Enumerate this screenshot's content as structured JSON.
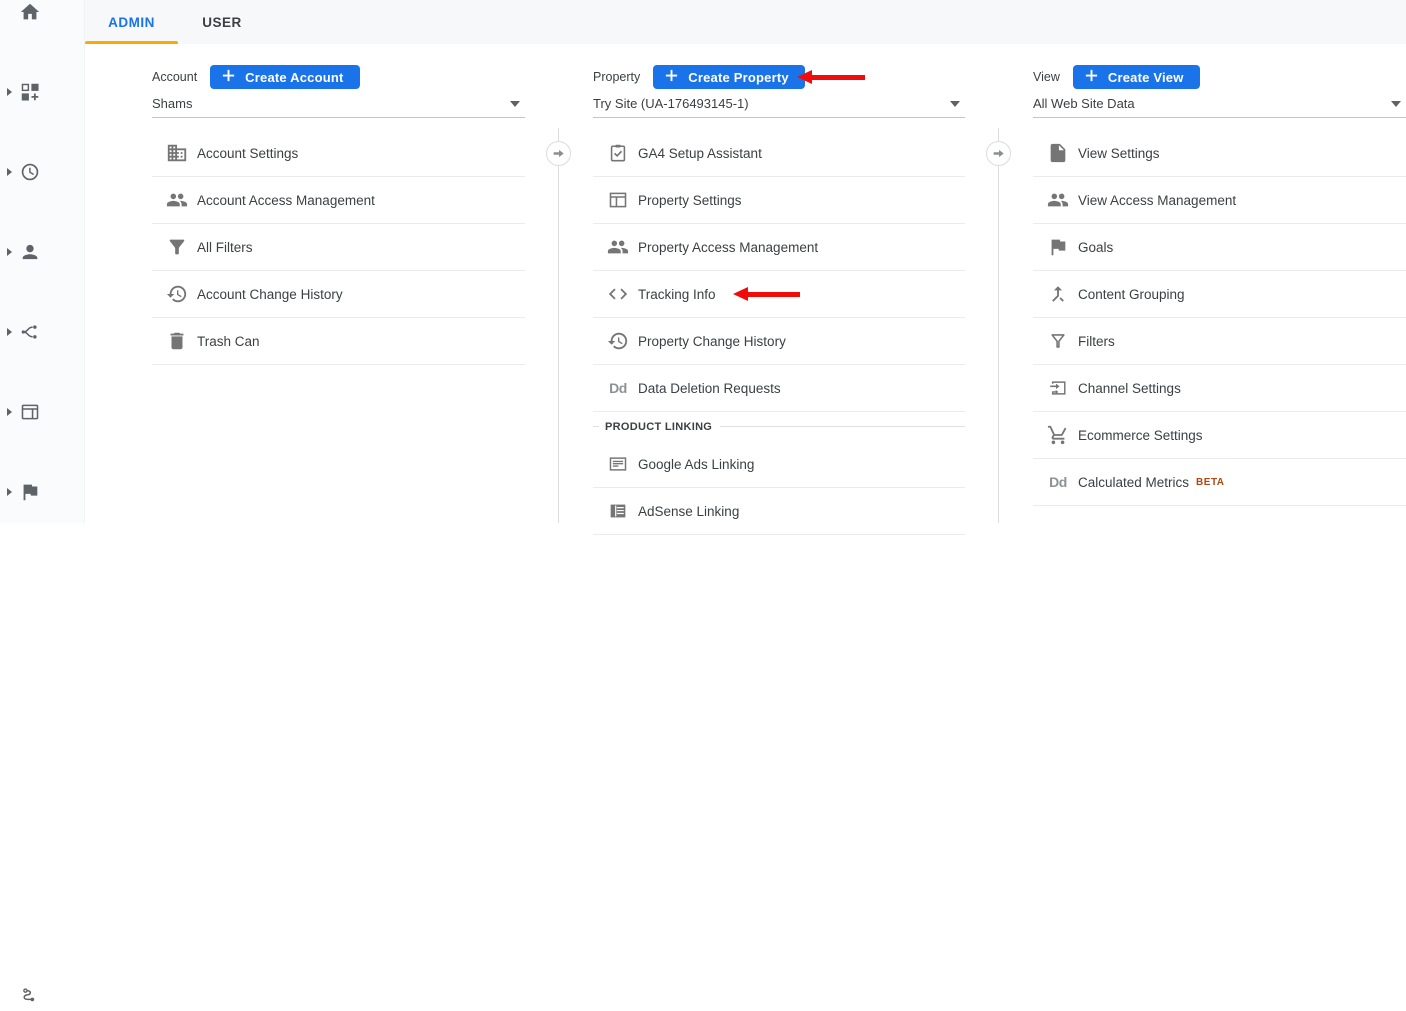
{
  "header": {
    "tabs": [
      {
        "label": "ADMIN",
        "active": true
      },
      {
        "label": "USER",
        "active": false
      }
    ]
  },
  "sidebar": {
    "icons": [
      "home-icon",
      "grid-plus-customization-icon",
      "clock-realtime-icon",
      "person-audience-icon",
      "branch-acquisition-icon",
      "browser-card-behavior-icon",
      "flag-conversions-icon",
      "curve-route-attribution-icon"
    ]
  },
  "glyphs": {
    "dd": "Dd"
  },
  "colors": {
    "accent_blue": "#1a73e8",
    "tab_indicator_orange": "#f9ab00",
    "header_background": "#f6f8fa",
    "annotation_red": "#f10c0c",
    "beta_badge": "#b3470f",
    "icon_gray": "#757575"
  },
  "account_column": {
    "entity_label": "Account",
    "create_button": "Create Account",
    "selected": "Shams",
    "items": [
      {
        "icon": "building-icon",
        "label": "Account Settings"
      },
      {
        "icon": "people-icon",
        "label": "Account Access Management"
      },
      {
        "icon": "filter-filled-icon",
        "label": "All Filters"
      },
      {
        "icon": "history-icon",
        "label": "Account Change History"
      },
      {
        "icon": "trash-icon",
        "label": "Trash Can"
      }
    ]
  },
  "property_column": {
    "entity_label": "Property",
    "create_button": "Create Property",
    "selected": "Try Site (UA-176493145-1)",
    "items": [
      {
        "icon": "clipboard-check-icon",
        "label": "GA4 Setup Assistant"
      },
      {
        "icon": "layout-icon",
        "label": "Property Settings"
      },
      {
        "icon": "people-icon",
        "label": "Property Access Management"
      },
      {
        "icon": "code-icon",
        "label": "Tracking Info"
      },
      {
        "icon": "history-icon",
        "label": "Property Change History"
      },
      {
        "icon": "dd-letters-icon",
        "label": "Data Deletion Requests"
      }
    ],
    "section_title": "PRODUCT LINKING",
    "section_items": [
      {
        "icon": "ads-lines-icon",
        "label": "Google Ads Linking"
      },
      {
        "icon": "adsense-filled-icon",
        "label": "AdSense Linking"
      }
    ]
  },
  "view_column": {
    "entity_label": "View",
    "create_button": "Create View",
    "selected": "All Web Site Data",
    "items": [
      {
        "icon": "page-icon",
        "label": "View Settings"
      },
      {
        "icon": "people-icon",
        "label": "View Access Management"
      },
      {
        "icon": "flag-icon",
        "label": "Goals"
      },
      {
        "icon": "merge-icon",
        "label": "Content Grouping"
      },
      {
        "icon": "filter-outline-icon",
        "label": "Filters"
      },
      {
        "icon": "channel-arrows-icon",
        "label": "Channel Settings"
      },
      {
        "icon": "cart-icon",
        "label": "Ecommerce Settings"
      },
      {
        "icon": "dd-letters-icon",
        "label": "Calculated Metrics",
        "badge": "BETA"
      }
    ]
  },
  "annotations": {
    "arrows": [
      {
        "color": "#f10c0c",
        "pointing_at": "Create Property"
      },
      {
        "color": "#f10c0c",
        "pointing_at": "Tracking Info"
      }
    ]
  }
}
